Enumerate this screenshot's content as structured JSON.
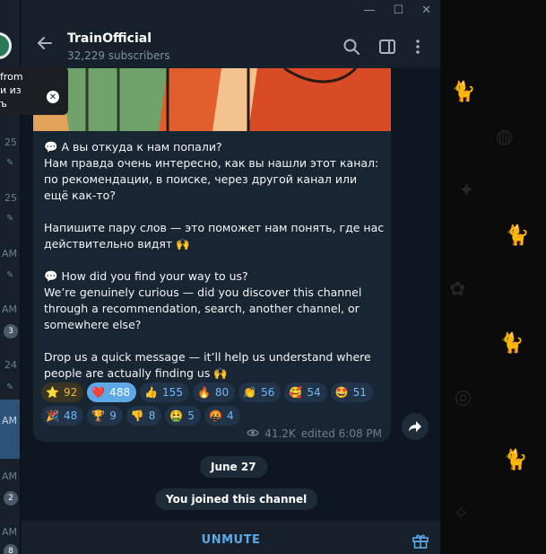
{
  "sidebar": {
    "items": [
      {
        "time": "25",
        "pinned": true
      },
      {
        "time": "25",
        "pinned": true
      },
      {
        "time": "AM",
        "pinned": true
      },
      {
        "time": "AM",
        "badge": "3"
      },
      {
        "time": "24",
        "pinned": true
      },
      {
        "time": "AM"
      },
      {
        "time": "AM",
        "badge": "2"
      },
      {
        "time": "AM",
        "badge": "8"
      }
    ]
  },
  "tooltip": {
    "lines": [
      "from",
      "и из",
      "ъ"
    ]
  },
  "window": {
    "minimize": "—",
    "maximize": "☐",
    "close": "✕"
  },
  "header": {
    "title": "TrainOfficial",
    "subtitle": "32,229 subscribers"
  },
  "message": {
    "ru_q": "💬 А вы откуда к нам попали?",
    "ru_p1": "Нам правда очень интересно, как вы нашли этот канал: по рекомендации, в поиске, через другой канал или ещё как-то?",
    "ru_p2": "Напишите пару слов — это поможет нам понять, где нас действительно видят 🙌",
    "en_q": "💬 How did you find your way to us?",
    "en_p1": "We’re genuinely curious — did you discover this channel through a recommendation, search, another channel, or somewhere else?",
    "en_p2": "Drop us a quick message — it’ll help us understand where people are actually finding us 🙌",
    "views": "41.2K",
    "edited": "edited 6:08 PM"
  },
  "reactions": [
    {
      "emoji": "⭐",
      "count": "92"
    },
    {
      "emoji": "❤️",
      "count": "488"
    },
    {
      "emoji": "👍",
      "count": "155"
    },
    {
      "emoji": "🔥",
      "count": "80"
    },
    {
      "emoji": "👏",
      "count": "56"
    },
    {
      "emoji": "🥰",
      "count": "54"
    },
    {
      "emoji": "🤩",
      "count": "51"
    },
    {
      "emoji": "🎉",
      "count": "48"
    },
    {
      "emoji": "🏆",
      "count": "9"
    },
    {
      "emoji": "👎",
      "count": "8"
    },
    {
      "emoji": "🤮",
      "count": "5"
    },
    {
      "emoji": "🤬",
      "count": "4"
    }
  ],
  "service": {
    "date": "June 27",
    "joined": "You joined this channel"
  },
  "bottom": {
    "unmute": "UNMUTE"
  },
  "icons": {
    "back": "back-arrow-icon",
    "search": "search-icon",
    "sidebar_toggle": "sidebar-toggle-icon",
    "menu": "more-vertical-icon",
    "share": "share-icon",
    "views": "eye-icon",
    "gift": "gift-icon"
  },
  "colors": {
    "accent": "#5fa8e8",
    "bubble": "#182533",
    "header": "#17212b",
    "background": "#0e1621"
  }
}
